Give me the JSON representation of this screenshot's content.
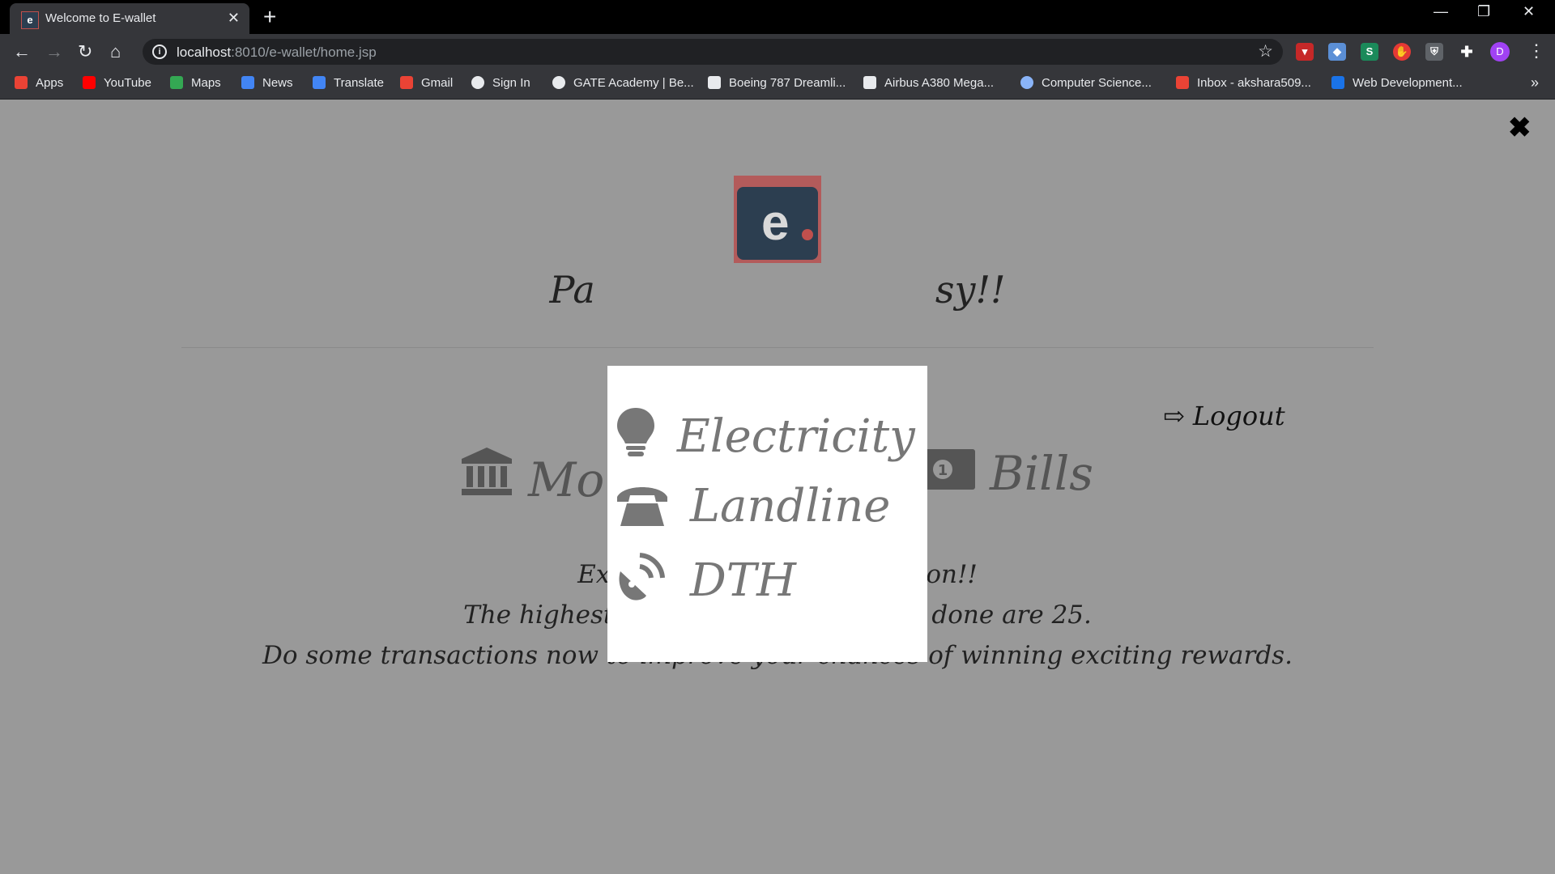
{
  "browser": {
    "tab_title": "Welcome to E-wallet",
    "favicon_text": "e",
    "new_tab": "+",
    "tab_close": "✕",
    "url_host": "localhost",
    "url_path": ":8010/e-wallet/home.jsp",
    "window_controls": {
      "minimize": "—",
      "restore": "❐",
      "close": "✕"
    },
    "nav": {
      "back": "←",
      "forward": "→",
      "reload": "↻",
      "home": "⌂"
    },
    "star": "☆",
    "profile_initial": "D",
    "more": "»",
    "menu": "⋮"
  },
  "bookmarks": [
    {
      "label": "Apps",
      "icon": "apps-grid-icon",
      "color": "#ea4335"
    },
    {
      "label": "YouTube",
      "icon": "youtube-icon",
      "color": "#ff0000"
    },
    {
      "label": "Maps",
      "icon": "maps-icon",
      "color": "#34a853"
    },
    {
      "label": "News",
      "icon": "news-icon",
      "color": "#4285f4"
    },
    {
      "label": "Translate",
      "icon": "translate-icon",
      "color": "#4285f4"
    },
    {
      "label": "Gmail",
      "icon": "gmail-icon",
      "color": "#ea4335"
    },
    {
      "label": "Sign In",
      "icon": "globe-icon",
      "color": "#e8eaed"
    },
    {
      "label": "GATE Academy | Be...",
      "icon": "gate-academy-icon",
      "color": "#e8eaed"
    },
    {
      "label": "Boeing 787 Dreamli...",
      "icon": "page-icon",
      "color": "#e8eaed"
    },
    {
      "label": "Airbus A380 Mega...",
      "icon": "page-icon",
      "color": "#e8eaed"
    },
    {
      "label": "Computer Science...",
      "icon": "infinity-icon",
      "color": "#8ab4f8"
    },
    {
      "label": "Inbox - akshara509...",
      "icon": "gmail-icon",
      "color": "#ea4335"
    },
    {
      "label": "Web Development...",
      "icon": "is-icon",
      "color": "#1a73e8"
    }
  ],
  "page": {
    "close_symbol": "✖",
    "tagline_left": "Pa",
    "tagline_right": "sy!!",
    "logout_label": "Logout",
    "logout_icon": "sign-out-icon",
    "features": [
      {
        "label": "Mon",
        "icon": "bank-icon"
      },
      {
        "label": "Bills",
        "icon": "money-bill-icon"
      }
    ],
    "reward_lines": [
      "Exciting Reward coming soon!!",
      "The highest number Of transactions done are 25.",
      "Do some transactions now to improve your chances of winning exciting rewards."
    ],
    "colors": {
      "overlay_bg": "#999999",
      "logo_red": "#c0504d",
      "logo_navy": "#2c3e50",
      "modal_bg": "#ffffff"
    }
  },
  "modal": {
    "items": [
      {
        "label": "Electricity",
        "icon": "lightbulb-icon"
      },
      {
        "label": "Landline",
        "icon": "phone-icon"
      },
      {
        "label": "DTH",
        "icon": "satellite-dish-icon"
      }
    ]
  }
}
